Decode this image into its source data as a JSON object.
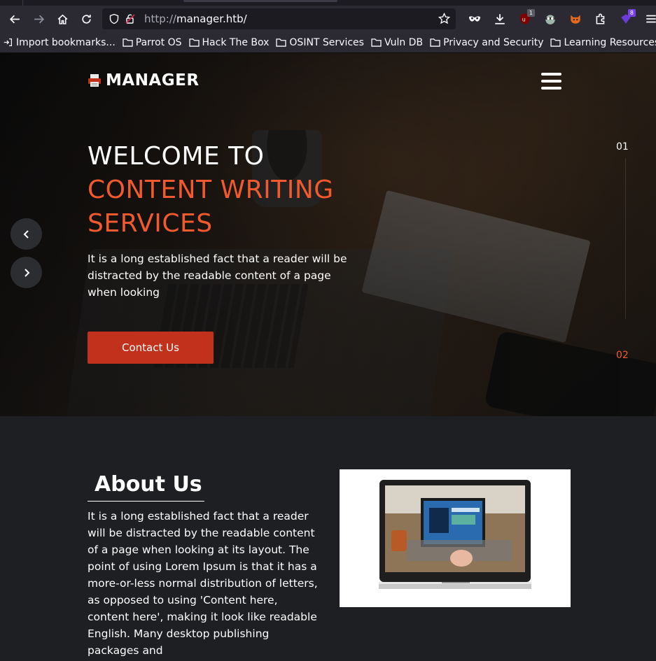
{
  "browser": {
    "url_scheme": "http://",
    "url_host": "manager.htb/",
    "badges": {
      "ublock": "1",
      "extension": "8"
    },
    "bookmarks": [
      "Import bookmarks...",
      "Parrot OS",
      "Hack The Box",
      "OSINT Services",
      "Vuln DB",
      "Privacy and Security",
      "Learning Resources"
    ]
  },
  "site": {
    "brand": "MANAGER",
    "hero": {
      "line1": "WELCOME TO",
      "line2": "CONTENT WRITING",
      "line3": "SERVICES",
      "text": "It is a long established fact that a reader will be distracted by the readable content of a page when looking",
      "cta": "Contact Us",
      "slide_current": "01",
      "slide_next": "02"
    },
    "about": {
      "title": "About Us",
      "text": "It is a long established fact that a reader will be distracted by the readable content of a page when looking at its layout. The point of using Lorem Ipsum is that it has a more-or-less normal distribution of letters, as opposed to using 'Content here, content here', making it look like readable English. Many desktop publishing packages and"
    }
  },
  "colors": {
    "accent": "#f05a2e",
    "button": "#c2311b",
    "page_bg": "#1d1f22"
  }
}
